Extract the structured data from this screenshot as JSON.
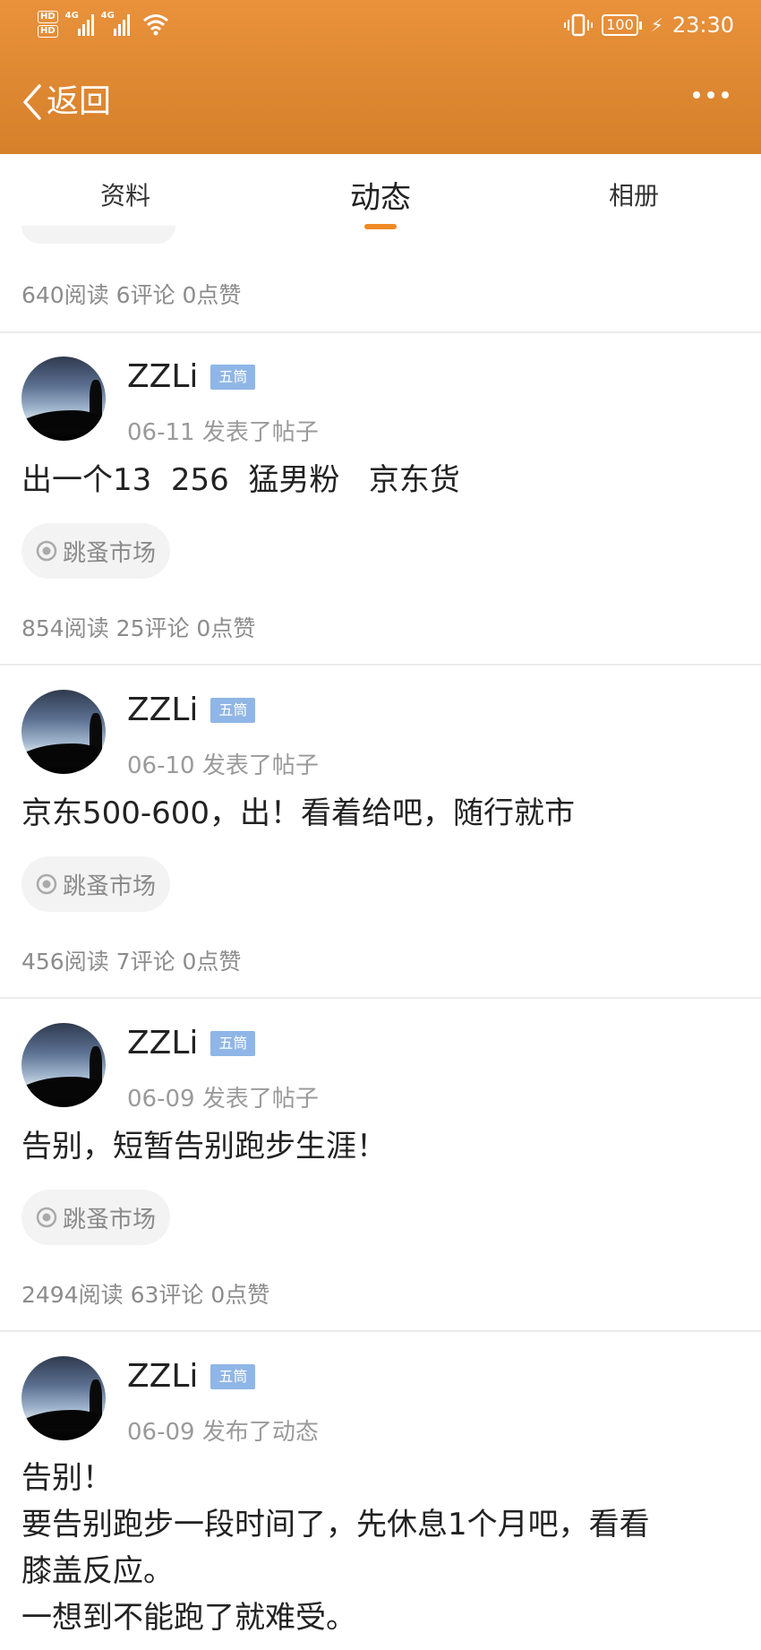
{
  "status_bar": {
    "hd1": "HD",
    "hd2": "HD",
    "sig1": "4G",
    "sig2": "4G",
    "battery": "100",
    "time": "23:30"
  },
  "nav": {
    "back_label": "返回"
  },
  "tabs": [
    {
      "label": "资料",
      "active": false
    },
    {
      "label": "动态",
      "active": true
    },
    {
      "label": "相册",
      "active": false
    }
  ],
  "accent_color": "#f08a24",
  "header_color": "#e08a36",
  "feed": {
    "top_stats": "640阅读 6评论 0点赞",
    "posts": [
      {
        "author": "ZZLi",
        "badge": "五筒",
        "meta": "06-11  发表了帖子",
        "content": "出一个13  256  猛男粉   京东货",
        "tag": "跳蚤市场",
        "stats": "854阅读 25评论 0点赞"
      },
      {
        "author": "ZZLi",
        "badge": "五筒",
        "meta": "06-10  发表了帖子",
        "content": "京东500-600，出！看着给吧，随行就市",
        "tag": "跳蚤市场",
        "stats": "456阅读 7评论 0点赞"
      },
      {
        "author": "ZZLi",
        "badge": "五筒",
        "meta": "06-09  发表了帖子",
        "content": "告别，短暂告别跑步生涯！",
        "tag": "跳蚤市场",
        "stats": "2494阅读 63评论 0点赞"
      },
      {
        "author": "ZZLi",
        "badge": "五筒",
        "meta": "06-09  发布了动态",
        "content": "告别！\n要告别跑步一段时间了，先休息1个月吧，看看\n膝盖反应。\n一想到不能跑了就难受。"
      }
    ]
  }
}
